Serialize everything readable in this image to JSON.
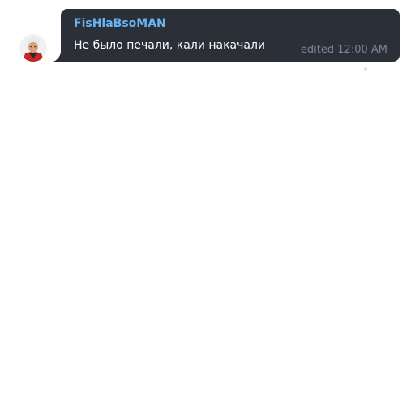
{
  "message": {
    "sender": "FisHlaBsoMAN",
    "text": "Не было печали, кали накачали",
    "edited_label": "edited",
    "time": "12:00 AM",
    "avatar_icon": "anime-character-avatar-icon"
  },
  "colors": {
    "bubble": "#2b3038",
    "sender": "#6ab3f3",
    "text": "#ffffff",
    "meta": "#7d8590",
    "background": "#ffffff"
  }
}
